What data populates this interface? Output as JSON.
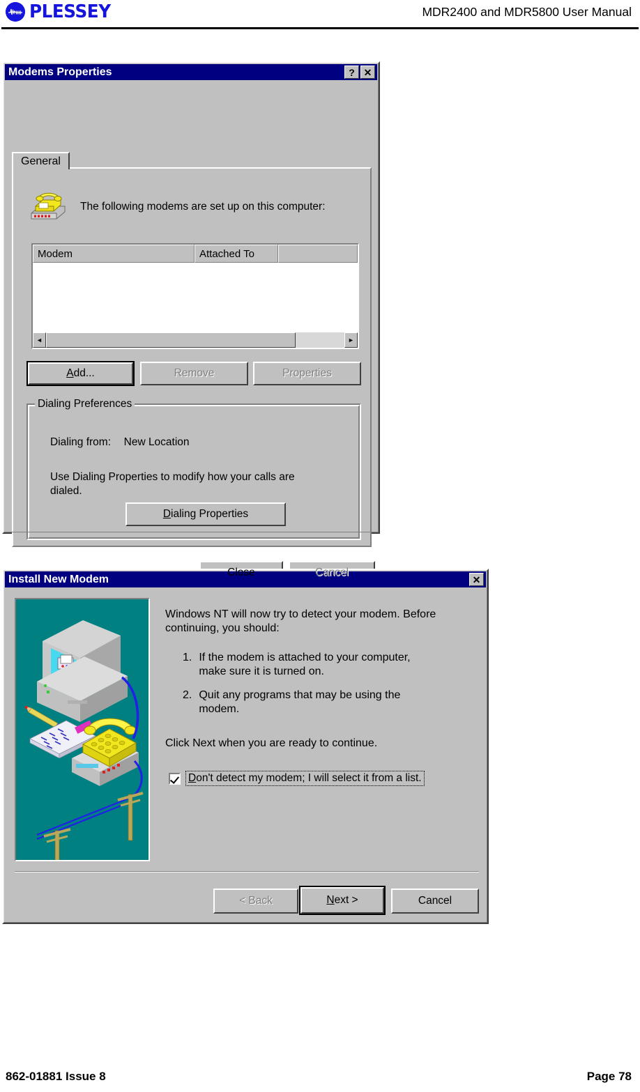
{
  "page_header": {
    "logo_text": "PLESSEY",
    "logo_icon": "plessey-waveform-logo",
    "manual_title": "MDR2400 and MDR5800 User Manual"
  },
  "footer": {
    "document_number": "862-01881 Issue 8",
    "page_number": "Page 78"
  },
  "modems_properties_dialog": {
    "title": "Modems Properties",
    "titlebar_buttons": [
      {
        "name": "help-button",
        "glyph": "?"
      },
      {
        "name": "close-button",
        "glyph": "✕"
      }
    ],
    "tabs": [
      {
        "label": "General",
        "selected": true
      }
    ],
    "icon": "modem-telephone-icon",
    "description": "The following modems are set up on this computer:",
    "list": {
      "columns": [
        "Modem",
        "Attached To",
        ""
      ],
      "rows": [],
      "scrollbar": {
        "left_arrow": "◄",
        "right_arrow": "►"
      }
    },
    "buttons": [
      {
        "label": "Add...",
        "accesskey": "A",
        "enabled": true,
        "default": true,
        "name": "add-button"
      },
      {
        "label": "Remove",
        "accesskey": "R",
        "enabled": false,
        "default": false,
        "name": "remove-button"
      },
      {
        "label": "Properties",
        "accesskey": "P",
        "enabled": false,
        "default": false,
        "name": "properties-button"
      }
    ],
    "dialing_preferences": {
      "group_label": "Dialing Preferences",
      "dialing_from_label": "Dialing from:",
      "dialing_from_value": "New Location",
      "hint": "Use Dialing Properties to modify how your calls are dialed.",
      "dialing_properties_button": {
        "label": "Dialing Properties",
        "accesskey": "D",
        "enabled": true
      }
    },
    "footer_buttons": [
      {
        "label": "Close",
        "enabled": true,
        "name": "close-dialog-button"
      },
      {
        "label": "Cancel",
        "enabled": false,
        "name": "cancel-dialog-button"
      }
    ]
  },
  "install_new_modem_dialog": {
    "title": "Install New Modem",
    "titlebar_buttons": [
      {
        "name": "close-button",
        "glyph": "✕"
      }
    ],
    "artwork": "modem-computer-telephone-illustration",
    "intro_text": "Windows NT will now try to detect your modem.  Before continuing, you should:",
    "steps": [
      {
        "number": "1.",
        "text": "If the modem is attached to your computer, make sure it is turned on."
      },
      {
        "number": "2.",
        "text": "Quit any programs that may be using the modem."
      }
    ],
    "continue_text": "Click Next when you are ready to continue.",
    "checkbox": {
      "checked": true,
      "label_prefix": "D",
      "label_rest": "on't detect my modem; I will select it from a list.",
      "focused": true
    },
    "footer_buttons": [
      {
        "label": "< Back",
        "accesskey": "B",
        "enabled": false,
        "default": false,
        "name": "back-button"
      },
      {
        "label": "Next >",
        "accesskey": "N",
        "enabled": true,
        "default": true,
        "name": "next-button"
      },
      {
        "label": "Cancel",
        "enabled": true,
        "default": false,
        "name": "cancel-button"
      }
    ]
  },
  "colors": {
    "brand_blue": "#1414dc",
    "titlebar_blue": "#000080",
    "dialog_face": "#c0c0c0",
    "wizard_art_teal": "#008080"
  }
}
